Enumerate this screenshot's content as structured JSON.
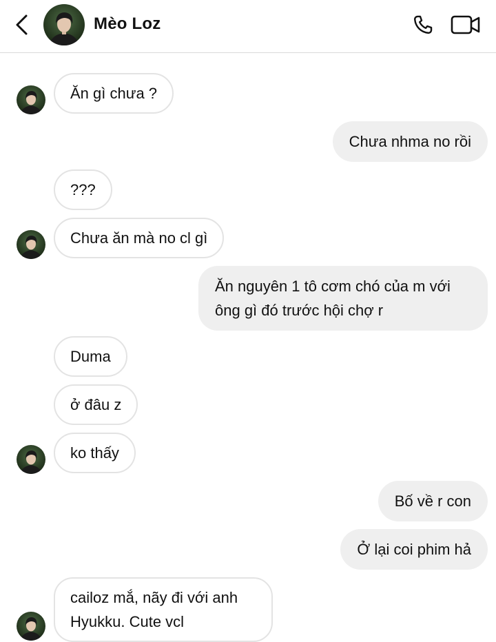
{
  "header": {
    "contact_name": "Mèo Loz",
    "back_icon": "chevron-left-icon",
    "call_icon": "phone-icon",
    "video_icon": "video-camera-icon"
  },
  "colors": {
    "incoming_bubble_bg": "#ffffff",
    "incoming_bubble_border": "#e3e3e3",
    "outgoing_bubble_bg": "#efefef",
    "text": "#111111"
  },
  "messages": [
    {
      "direction": "incoming",
      "text": "Ăn gì chưa ?"
    },
    {
      "direction": "outgoing",
      "text": "Chưa nhma no rồi"
    },
    {
      "direction": "incoming",
      "text": "???"
    },
    {
      "direction": "incoming",
      "text": "Chưa ăn mà no cl gì"
    },
    {
      "direction": "outgoing",
      "text": "Ăn nguyên 1 tô cơm chó của m với ông gì đó trước hội chợ r"
    },
    {
      "direction": "incoming",
      "text": "Duma"
    },
    {
      "direction": "incoming",
      "text": "ở đâu z"
    },
    {
      "direction": "incoming",
      "text": "ko thấy"
    },
    {
      "direction": "outgoing",
      "text": "Bố về r con"
    },
    {
      "direction": "outgoing",
      "text": "Ở lại coi phim hả"
    },
    {
      "direction": "incoming",
      "text": "cailoz mắ, nãy đi với anh Hyukku. Cute vcl"
    }
  ]
}
